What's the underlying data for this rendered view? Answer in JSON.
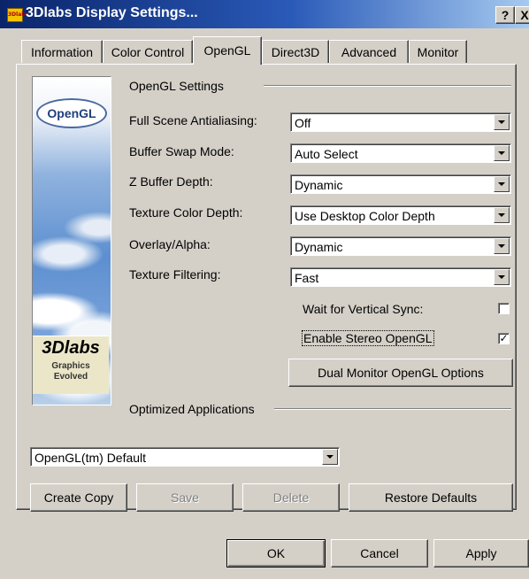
{
  "window": {
    "title": "3Dlabs Display Settings...",
    "app_icon_text": "3Dlabs",
    "help_button": "?",
    "close_button": "X"
  },
  "tabs": [
    {
      "label": "Information",
      "active": false
    },
    {
      "label": "Color Control",
      "active": false
    },
    {
      "label": "OpenGL",
      "active": true
    },
    {
      "label": "Direct3D",
      "active": false
    },
    {
      "label": "Advanced",
      "active": false
    },
    {
      "label": "Monitor",
      "active": false
    }
  ],
  "branding": {
    "opengl_logo": "OpenGL",
    "company_logo": "3Dlabs",
    "tagline_line1": "Graphics",
    "tagline_line2": "Evolved"
  },
  "opengl_settings": {
    "group_title": "OpenGL Settings",
    "fields": [
      {
        "label": "Full Scene Antialiasing:",
        "value": "Off"
      },
      {
        "label": "Buffer Swap Mode:",
        "value": "Auto Select"
      },
      {
        "label": "Z Buffer Depth:",
        "value": "Dynamic"
      },
      {
        "label": "Texture Color Depth:",
        "value": "Use Desktop Color Depth"
      },
      {
        "label": "Overlay/Alpha:",
        "value": "Dynamic"
      },
      {
        "label": "Texture Filtering:",
        "value": "Fast"
      }
    ],
    "wait_vsync": {
      "label": "Wait for Vertical Sync:",
      "checked": false
    },
    "stereo": {
      "label": "Enable Stereo OpenGL",
      "checked": true
    },
    "dual_monitor_button": "Dual Monitor OpenGL Options"
  },
  "optimized_apps": {
    "group_title": "Optimized Applications",
    "selected": "OpenGL(tm) Default",
    "buttons": {
      "create_copy": "Create Copy",
      "save": "Save",
      "delete": "Delete",
      "restore_defaults": "Restore Defaults"
    }
  },
  "dialog_buttons": {
    "ok": "OK",
    "cancel": "Cancel",
    "apply": "Apply"
  },
  "colors": {
    "face": "#d4d0c8",
    "title_active": "#0a246a",
    "title_gradient_end": "#a6caf0"
  }
}
